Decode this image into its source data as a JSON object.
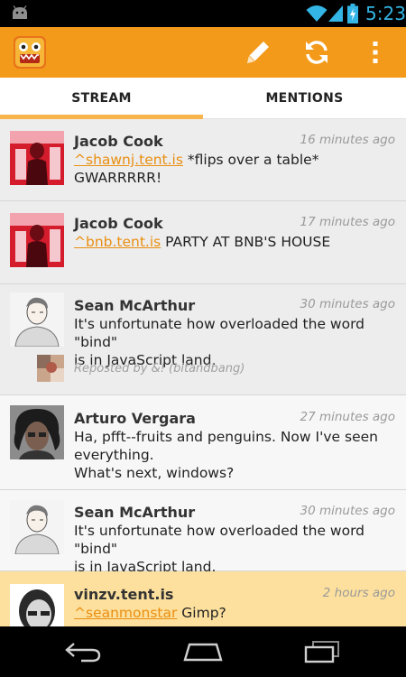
{
  "status_bar": {
    "time": "5:23"
  },
  "action_bar": {
    "logo_icon": "tent-monster-logo-icon",
    "icons": [
      "pencil-icon",
      "refresh-icon",
      "overflow-menu-icon"
    ],
    "accent_color": "#f39a1b"
  },
  "tabs": [
    {
      "label": "STREAM",
      "selected": true
    },
    {
      "label": "MENTIONS",
      "selected": false
    }
  ],
  "posts": [
    {
      "name": "Jacob Cook",
      "time": "16 minutes ago",
      "mention": "^shawnj.tent.is",
      "text": " *flips over a table* GWARRRRR!"
    },
    {
      "name": "Jacob Cook",
      "time": "17 minutes ago",
      "mention": "^bnb.tent.is",
      "text": " PARTY AT BNB'S HOUSE"
    },
    {
      "name": "Sean McArthur",
      "time": "30 minutes ago",
      "line1": "It's unfortunate how overloaded the word \"bind\"",
      "line2": "is in JavaScript land.",
      "repost": "Reposted by &! (bitandbang)"
    },
    {
      "name": "Arturo Vergara",
      "time": "27 minutes ago",
      "line1": "Ha, pfft--fruits and penguins. Now I've seen",
      "line2": "everything.",
      "line3": "What's next, windows?"
    },
    {
      "name": "Sean McArthur",
      "time": "30 minutes ago",
      "line1": "It's unfortunate how overloaded the word \"bind\"",
      "line2": "is in JavaScript land."
    },
    {
      "name": "vinzv.tent.is",
      "time": "2 hours ago",
      "mention": "^seanmonstar",
      "text": " Gimp?"
    }
  ],
  "nav_bar": {
    "icons": [
      "back-icon",
      "home-icon",
      "recent-apps-icon"
    ]
  }
}
